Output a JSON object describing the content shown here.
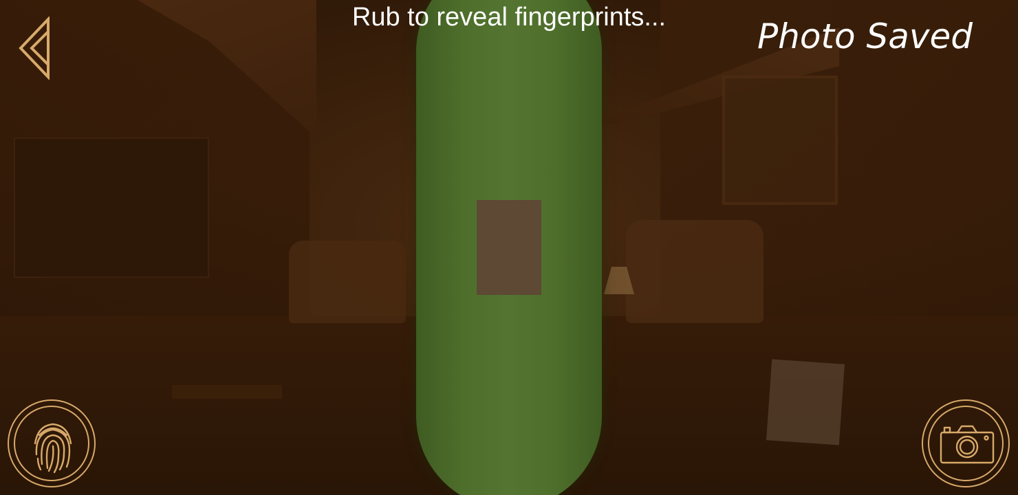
{
  "hud": {
    "hint": "Rub to reveal fingerprints...",
    "status": "Photo Saved"
  },
  "icons": {
    "back": "back-arrow-icon",
    "fingerprint": "fingerprint-icon",
    "camera": "camera-icon"
  },
  "colors": {
    "accent": "#d8aa6a",
    "object": "#547531",
    "patch": "#5e4935",
    "text": "#ffffff"
  }
}
